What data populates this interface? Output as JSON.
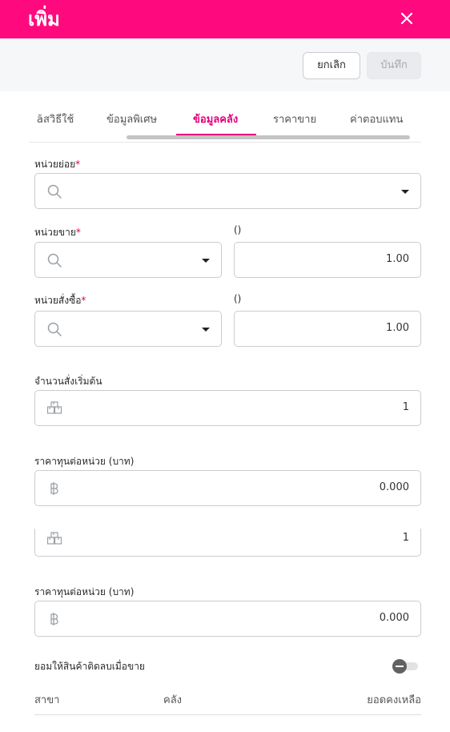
{
  "header": {
    "title": "เพิ่ม"
  },
  "toolbar": {
    "cancel_label": "ยกเลิก",
    "save_label": "บันทึก"
  },
  "tabs": [
    {
      "label": "ãสวิธีใช้",
      "active": false
    },
    {
      "label": "ข้อมูลพิเศษ",
      "active": false
    },
    {
      "label": "ข้อมูลคลัง",
      "active": true
    },
    {
      "label": "ราคาขาย",
      "active": false
    },
    {
      "label": "ค่าตอบแทน",
      "active": false
    }
  ],
  "form": {
    "sub_unit": {
      "label": "หน่วยย่อย",
      "required_mark": "*",
      "value": ""
    },
    "sale_unit": {
      "label": "หน่วยขาย",
      "required_mark": "*",
      "value": "",
      "ratio_label": "()",
      "ratio_value": "1.00"
    },
    "purchase_unit": {
      "label": "หน่วยสั่งซื้อ",
      "required_mark": "*",
      "value": "",
      "ratio_label": "()",
      "ratio_value": "1.00"
    },
    "initial_qty": {
      "label": "จำนวนสั่งเริ่มต้น",
      "value": "1"
    },
    "unit_cost": {
      "label": "ราคาทุนต่อหน่วย (บาท)",
      "value": "0.000"
    },
    "initial_qty_2": {
      "value": "1"
    },
    "unit_cost_2": {
      "label": "ราคาทุนต่อหน่วย (บาท)",
      "value": "0.000"
    },
    "allow_negative": {
      "label": "ยอมให้สินค้าติดลบเมื่อขาย",
      "enabled": false
    }
  },
  "stock_table": {
    "columns": [
      "สาขา",
      "คลัง",
      "ยอดคงเหลือ"
    ]
  },
  "icons": {
    "close": "close-icon",
    "search": "search-icon",
    "caret": "caret-down-icon",
    "boxes": "boxes-icon",
    "baht": "baht-icon"
  },
  "colors": {
    "brand": "#ff0a7e",
    "active_tab": "#e6007e",
    "required": "#e5003a"
  }
}
